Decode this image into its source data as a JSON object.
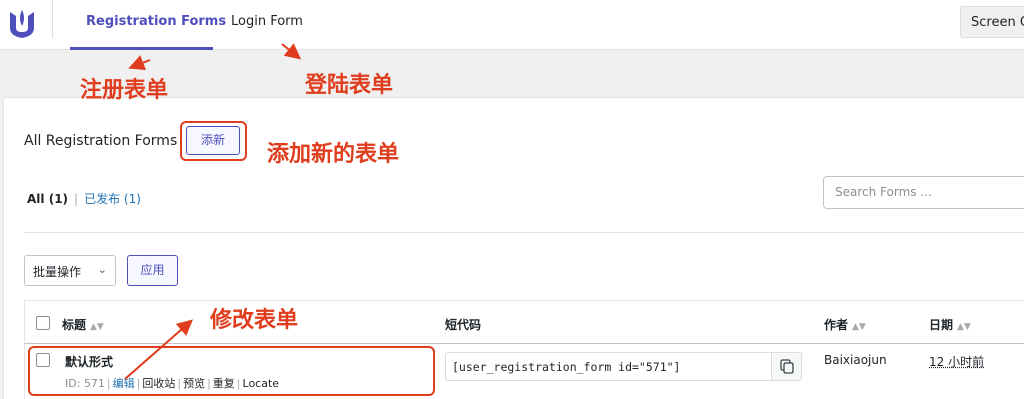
{
  "nav": {
    "tabs": [
      {
        "label": "Registration Forms",
        "active": true
      },
      {
        "label": "Login Form",
        "active": false
      }
    ],
    "screen_options": "Screen Options"
  },
  "header": {
    "title": "All Registration Forms",
    "add_new": "添新"
  },
  "status_filters": {
    "all": "All",
    "all_count": "(1)",
    "published": "已发布",
    "published_count": "(1)"
  },
  "search": {
    "placeholder": "Search Forms ..."
  },
  "bulk": {
    "label": "批量操作",
    "apply": "应用"
  },
  "table": {
    "columns": [
      "标题",
      "短代码",
      "作者",
      "日期"
    ],
    "rows": [
      {
        "title": "默认形式",
        "id_text": "ID: 571",
        "actions": [
          "编辑",
          "回收站",
          "预览",
          "重复",
          "Locate"
        ],
        "shortcode": "[user_registration_form id=\"571\"]",
        "author": "Baixiaojun",
        "date": "12 小时前"
      }
    ]
  },
  "annotations": {
    "registration": "注册表单",
    "login": "登陆表单",
    "add_new": "添加新的表单",
    "edit": "修改表单"
  },
  "colors": {
    "accent": "#4e4fbd",
    "link": "#2271b1",
    "annotation": "#e03d1e"
  }
}
